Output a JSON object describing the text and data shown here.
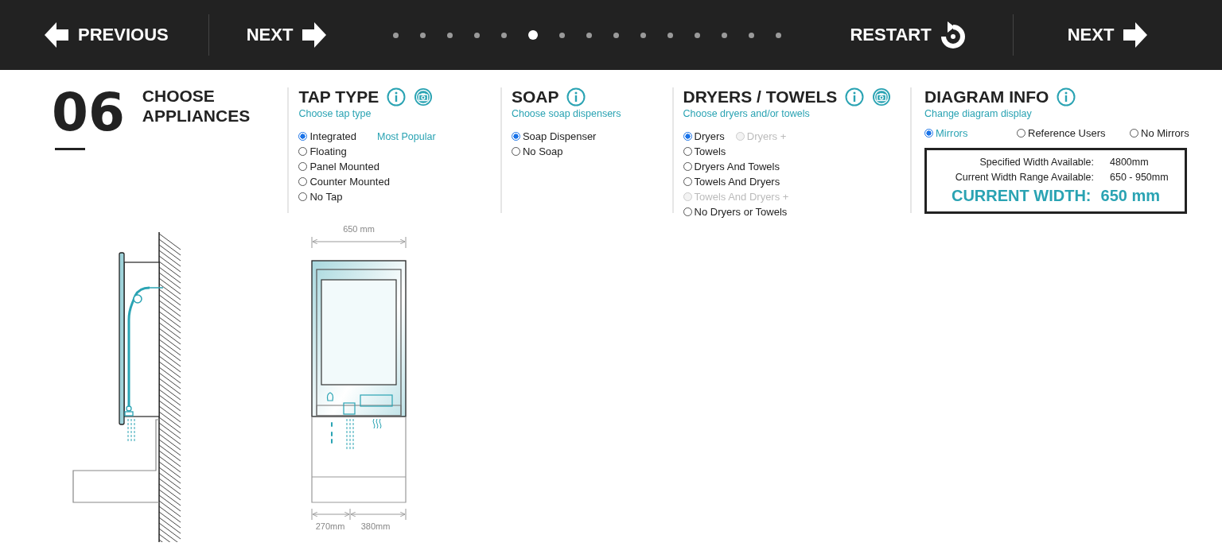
{
  "nav": {
    "previous": "PREVIOUS",
    "next": "NEXT",
    "restart": "RESTART",
    "next_end": "NEXT"
  },
  "steps": [
    {
      "selected": false
    },
    {
      "selected": false
    },
    {
      "selected": false
    },
    {
      "selected": false
    },
    {
      "selected": false
    },
    {
      "selected": true
    },
    {
      "selected": false
    },
    {
      "selected": false
    },
    {
      "selected": false
    },
    {
      "selected": false
    },
    {
      "selected": false
    },
    {
      "selected": false
    },
    {
      "selected": false
    },
    {
      "selected": false
    },
    {
      "selected": false
    }
  ],
  "step": {
    "number": "06",
    "title": "CHOOSE APPLIANCES"
  },
  "sections": [
    {
      "title": "TAP TYPE",
      "camera": true,
      "subtitle": "Choose tap type",
      "rows": [
        [
          {
            "label": "Integrated",
            "selected": true,
            "disabled": false,
            "note": "Most Popular"
          }
        ],
        [
          {
            "label": "Floating",
            "selected": false,
            "disabled": false
          }
        ],
        [
          {
            "label": "Panel Mounted",
            "selected": false,
            "disabled": false
          }
        ],
        [
          {
            "label": "Counter Mounted",
            "selected": false,
            "disabled": false
          }
        ],
        [
          {
            "label": "No Tap",
            "selected": false,
            "disabled": false
          }
        ]
      ]
    },
    {
      "title": "SOAP",
      "camera": false,
      "subtitle": "Choose soap dispensers",
      "rows": [
        [
          {
            "label": "Soap Dispenser",
            "selected": true,
            "disabled": false
          }
        ],
        [
          {
            "label": "No Soap",
            "selected": false,
            "disabled": false
          }
        ]
      ]
    },
    {
      "title": "DRYERS / TOWELS",
      "camera": true,
      "subtitle": "Choose dryers and/or towels",
      "rows": [
        [
          {
            "label": "Dryers",
            "selected": true,
            "disabled": false
          },
          {
            "label": "Dryers +",
            "selected": false,
            "disabled": true
          }
        ],
        [
          {
            "label": "Towels",
            "selected": false,
            "disabled": false
          }
        ],
        [
          {
            "label": "Dryers And Towels",
            "selected": false,
            "disabled": false
          }
        ],
        [
          {
            "label": "Towels And Dryers",
            "selected": false,
            "disabled": false
          }
        ],
        [
          {
            "label": "Towels And Dryers +",
            "selected": false,
            "disabled": true
          }
        ],
        [
          {
            "label": "No Dryers or Towels",
            "selected": false,
            "disabled": false
          }
        ]
      ]
    }
  ],
  "diagram_info": {
    "title": "DIAGRAM INFO",
    "subtitle": "Change diagram display",
    "options": [
      {
        "label": "Mirrors",
        "selected": true
      },
      {
        "label": "Reference Users",
        "selected": false
      },
      {
        "label": "No Mirrors",
        "selected": false
      }
    ],
    "facts": [
      {
        "label": "Specified Width Available:",
        "value": "4800mm"
      },
      {
        "label": "Current Width Range Available:",
        "value": "650 - 950mm"
      }
    ],
    "current": {
      "label": "CURRENT WIDTH:",
      "value": "650 mm"
    }
  },
  "diagram": {
    "width_label": "650 mm",
    "left_label": "270mm",
    "right_label": "380mm"
  }
}
